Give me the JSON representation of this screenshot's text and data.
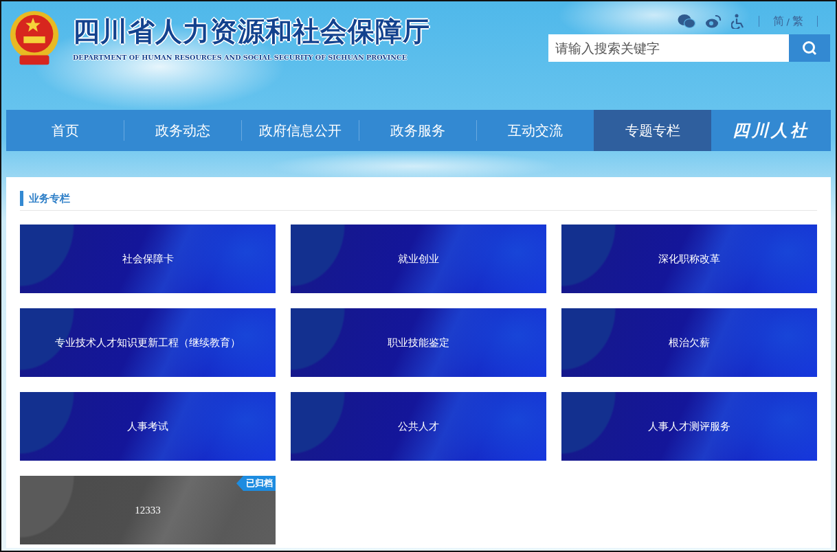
{
  "header": {
    "title": "四川省人力资源和社会保障厅",
    "subtitle": "DEPARTMENT OF HUMAN RESOURCES AND SOCIAL SECURITY OF SICHUAN PROVINCE",
    "languages": [
      {
        "label": "简"
      },
      {
        "label": "繁"
      }
    ],
    "language_separator": "/"
  },
  "search": {
    "placeholder": "请输入搜索关键字"
  },
  "nav": {
    "items": [
      {
        "label": "首页",
        "selected": false
      },
      {
        "label": "政务动态",
        "selected": false
      },
      {
        "label": "政府信息公开",
        "selected": false
      },
      {
        "label": "政务服务",
        "selected": false
      },
      {
        "label": "互动交流",
        "selected": false
      },
      {
        "label": "专题专栏",
        "selected": true
      }
    ],
    "logo_text": "四川人社"
  },
  "section": {
    "title": "业务专栏",
    "cards": [
      {
        "label": "社会保障卡",
        "archived": false
      },
      {
        "label": "就业创业",
        "archived": false
      },
      {
        "label": "深化职称改革",
        "archived": false
      },
      {
        "label": "专业技术人才知识更新工程（继续教育）",
        "archived": false
      },
      {
        "label": "职业技能鉴定",
        "archived": false
      },
      {
        "label": "根治欠薪",
        "archived": false
      },
      {
        "label": "人事考试",
        "archived": false
      },
      {
        "label": "公共人才",
        "archived": false
      },
      {
        "label": "人事人才测评服务",
        "archived": false
      },
      {
        "label": "12333",
        "archived": true,
        "badge": "已归档"
      }
    ]
  }
}
